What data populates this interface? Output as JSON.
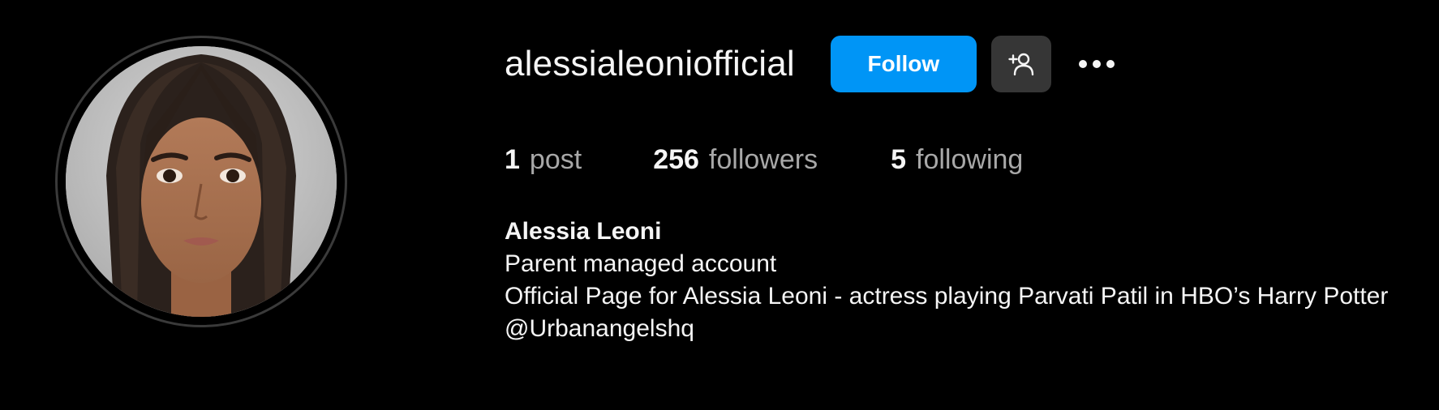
{
  "profile": {
    "username": "alessialeoniofficial",
    "follow_label": "Follow",
    "suggest_icon": "add-person-icon",
    "more_icon": "more-dots-icon",
    "avatar_icon": "profile-photo"
  },
  "stats": {
    "posts_count": "1",
    "posts_label": "post",
    "followers_count": "256",
    "followers_label": "followers",
    "following_count": "5",
    "following_label": "following"
  },
  "bio": {
    "full_name": "Alessia Leoni",
    "line1": "Parent managed account",
    "line2": "Official Page for Alessia Leoni - actress playing Parvati Patil in HBO’s Harry Potter",
    "line3": "@Urbanangelshq"
  },
  "colors": {
    "background": "#000000",
    "follow_button": "#0095f6",
    "secondary_button": "#363636",
    "muted_text": "#a8a8a8"
  }
}
